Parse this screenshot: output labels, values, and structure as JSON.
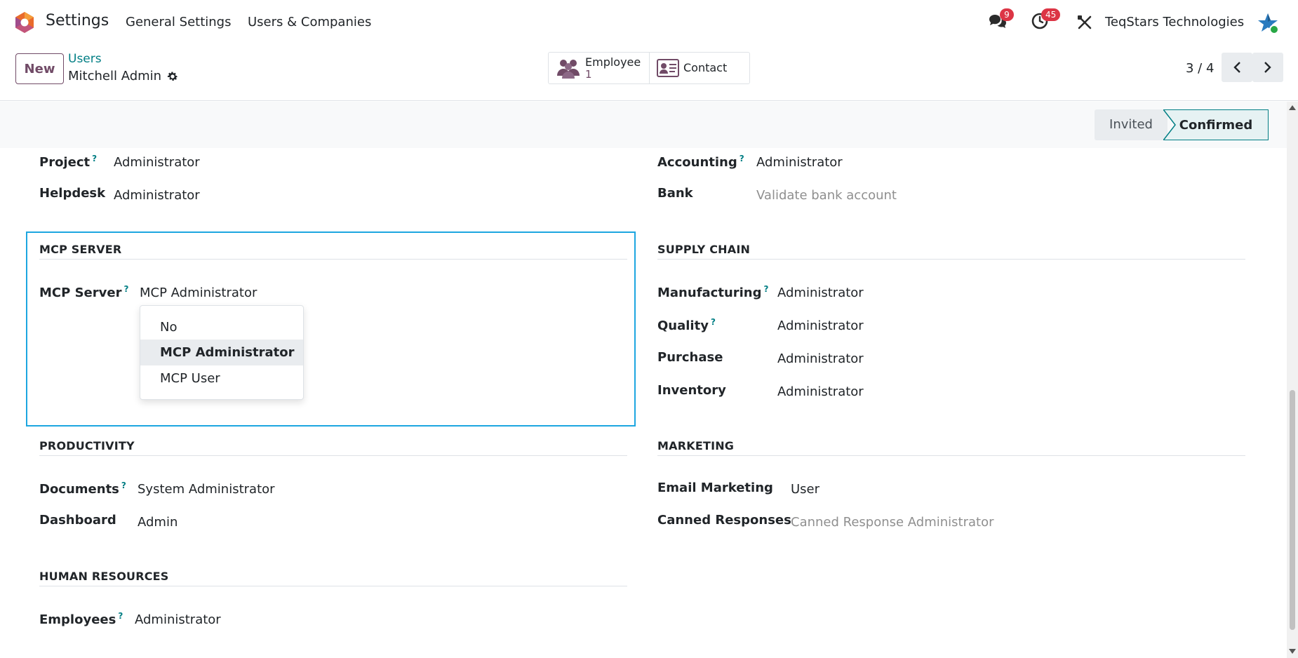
{
  "navbar": {
    "app_name": "Settings",
    "menus": [
      "General Settings",
      "Users & Companies"
    ],
    "messages_count": "9",
    "activities_count": "45",
    "company": "TeqStars Technologies"
  },
  "control": {
    "new_label": "New",
    "breadcrumb_parent": "Users",
    "breadcrumb_current": "Mitchell Admin",
    "smart_buttons": {
      "employee_label": "Employee",
      "employee_value": "1",
      "contact_label": "Contact"
    },
    "pager": "3 / 4"
  },
  "status": {
    "invited": "Invited",
    "confirmed": "Confirmed"
  },
  "fields": {
    "project_label": "Project",
    "project_value": "Administrator",
    "helpdesk_label": "Helpdesk",
    "helpdesk_value": "Administrator",
    "accounting_label": "Accounting",
    "accounting_value": "Administrator",
    "bank_label": "Bank",
    "bank_value": "Validate bank account"
  },
  "mcp": {
    "title": "MCP SERVER",
    "field_label": "MCP Server",
    "field_value": "MCP Administrator",
    "options": [
      "No",
      "MCP Administrator",
      "MCP User"
    ]
  },
  "supply_chain": {
    "title": "SUPPLY CHAIN",
    "manufacturing_label": "Manufacturing",
    "manufacturing_value": "Administrator",
    "quality_label": "Quality",
    "quality_value": "Administrator",
    "purchase_label": "Purchase",
    "purchase_value": "Administrator",
    "inventory_label": "Inventory",
    "inventory_value": "Administrator"
  },
  "productivity": {
    "title": "PRODUCTIVITY",
    "documents_label": "Documents",
    "documents_value": "System Administrator",
    "dashboard_label": "Dashboard",
    "dashboard_value": "Admin"
  },
  "marketing": {
    "title": "MARKETING",
    "email_label": "Email Marketing",
    "email_value": "User",
    "canned_label": "Canned Responses",
    "canned_value": "Canned Response Administrator"
  },
  "hr": {
    "title": "HUMAN RESOURCES",
    "employees_label": "Employees",
    "employees_value": "Administrator"
  },
  "help_marker": "?",
  "colors": {
    "brand": "#714b67",
    "accent": "#017e84",
    "focus": "#1da6e0",
    "badge": "#dc3545"
  }
}
